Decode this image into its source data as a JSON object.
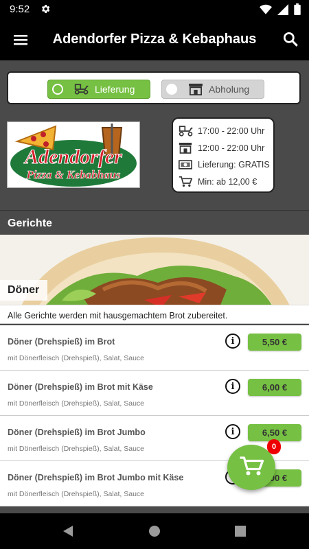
{
  "status_bar": {
    "time": "9:52"
  },
  "app_bar": {
    "title": "Adendorfer Pizza & Kebaphaus"
  },
  "order_type": {
    "delivery_label": "Lieferung",
    "pickup_label": "Abholung"
  },
  "logo": {
    "line1": "Adendorfer",
    "line2": "Pizza & Kebabhaus"
  },
  "info": {
    "delivery_hours": "17:00 - 22:00 Uhr",
    "pickup_hours": "12:00 - 22:00 Uhr",
    "delivery_fee": "Lieferung: GRATIS",
    "min_order": "Min: ab 12,00 €"
  },
  "section": {
    "title": "Gerichte"
  },
  "category": {
    "title": "Döner",
    "note": "Alle Gerichte werden mit hausgemachtem Brot zubereitet."
  },
  "items": [
    {
      "name": "Döner (Drehspieß) im Brot",
      "desc": "mit Dönerfleisch (Drehspieß), Salat, Sauce",
      "price": "5,50 €"
    },
    {
      "name": "Döner (Drehspieß) im Brot mit Käse",
      "desc": "mit Dönerfleisch (Drehspieß), Salat, Sauce",
      "price": "6,00 €"
    },
    {
      "name": "Döner (Drehspieß) im Brot Jumbo",
      "desc": "mit Dönerfleisch (Drehspieß), Salat, Sauce",
      "price": "6,50 €"
    },
    {
      "name": "Döner (Drehspieß) im Brot Jumbo mit Käse",
      "desc": "mit Dönerfleisch (Drehspieß), Salat, Sauce",
      "price": "7,00 €"
    }
  ],
  "cart": {
    "count": "0"
  },
  "colors": {
    "accent_green": "#76c043",
    "badge_red": "#e00000",
    "logo_red": "#d4202a",
    "logo_green": "#1f7a3a"
  },
  "icons": [
    "settings-icon",
    "wifi-icon",
    "signal-icon",
    "battery-icon",
    "menu-icon",
    "search-icon",
    "scooter-icon",
    "store-icon",
    "money-icon",
    "cart-icon",
    "info-icon",
    "back-icon",
    "home-icon",
    "recents-icon"
  ]
}
